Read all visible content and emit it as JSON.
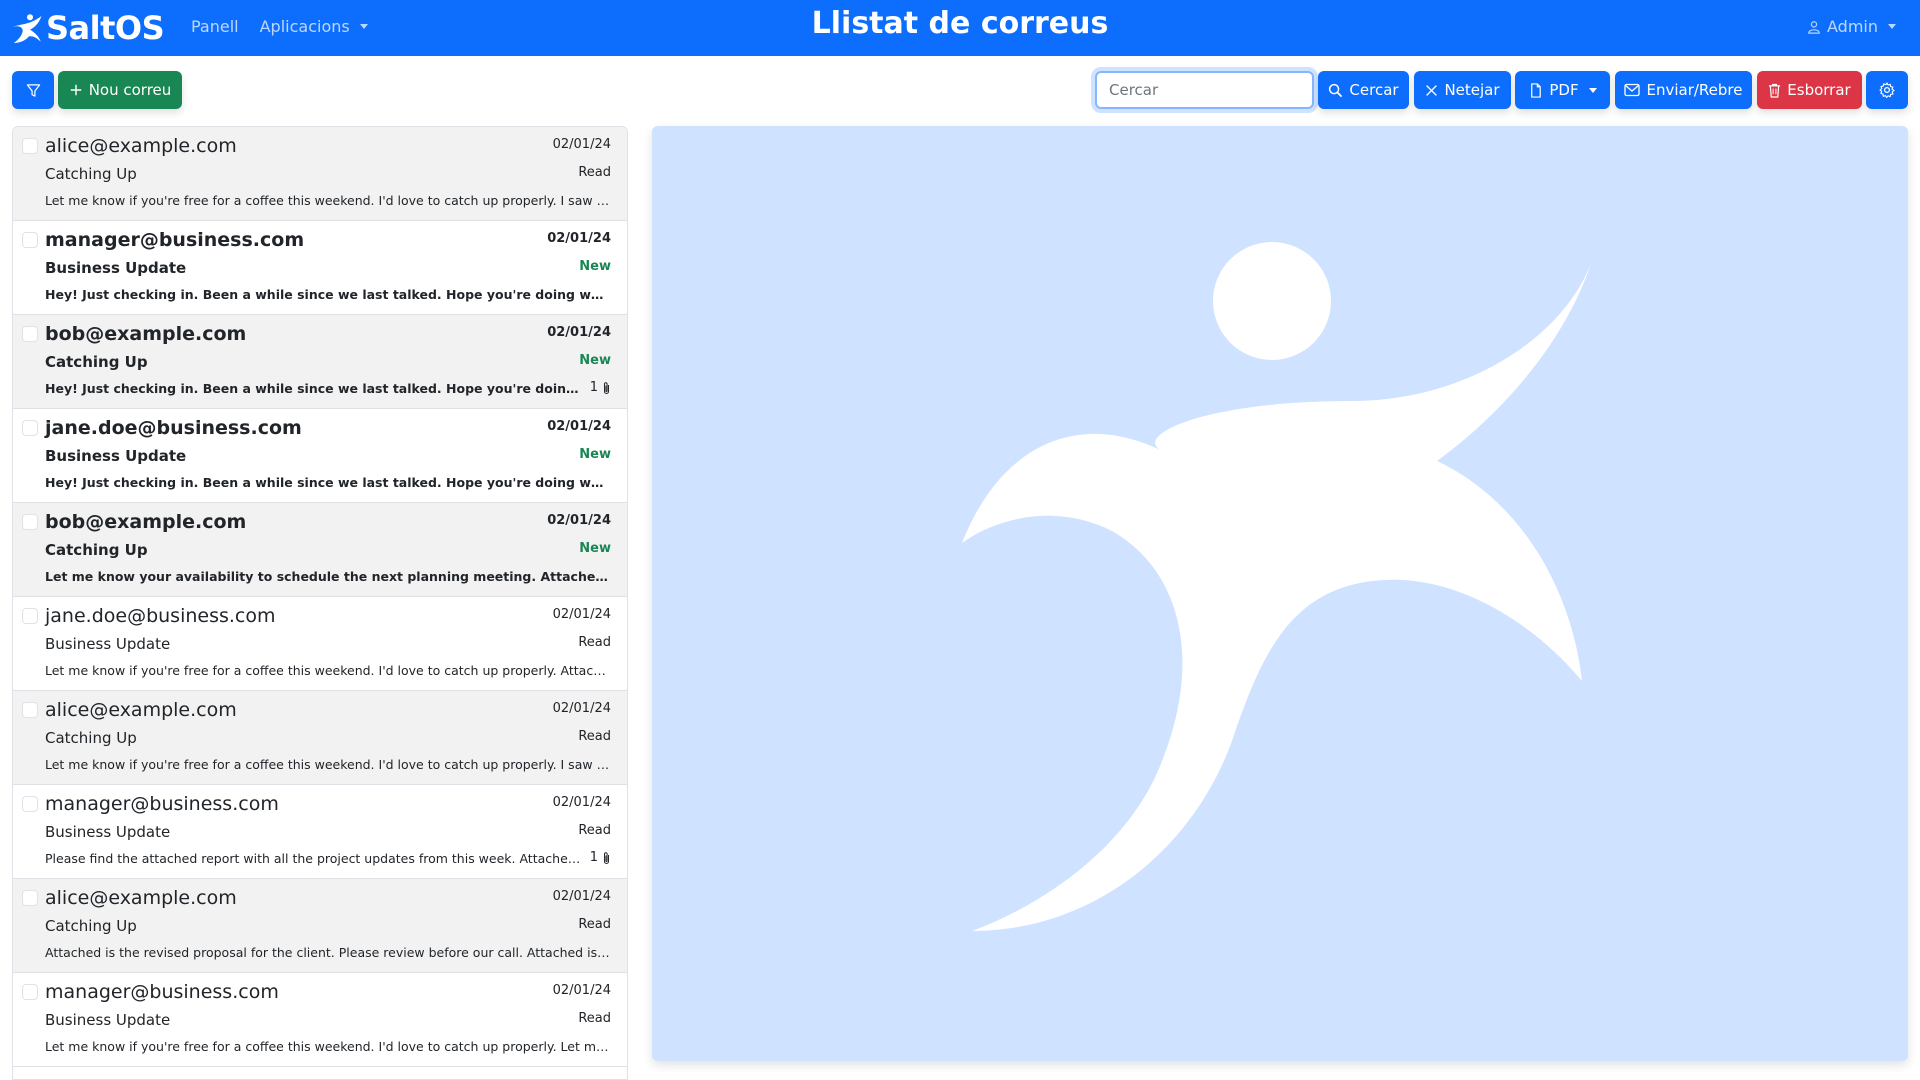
{
  "navbar": {
    "brand": "SaltOS",
    "links": [
      {
        "label": "Panell",
        "dropdown": false
      },
      {
        "label": "Aplicacions",
        "dropdown": true
      }
    ],
    "title": "Llistat de correus",
    "user": "Admin"
  },
  "toolbar": {
    "new_label": "Nou correu",
    "search_placeholder": "Cercar",
    "search_label": "Cercar",
    "clear_label": "Netejar",
    "pdf_label": "PDF",
    "send_receive_label": "Enviar/Rebre",
    "delete_label": "Esborrar"
  },
  "colors": {
    "primary": "#0d6efd",
    "success": "#198754",
    "danger": "#dc3545",
    "preview_bg": "#cfe2ff"
  },
  "emails": [
    {
      "from": "alice@example.com",
      "date": "02/01/24",
      "subject": "Catching Up",
      "status": "Read",
      "unread": false,
      "preview": "Let me know if you're free for a coffee this weekend. I'd love to catch up properly. I saw you at the market last week but you were busy.",
      "attachments": ""
    },
    {
      "from": "manager@business.com",
      "date": "02/01/24",
      "subject": "Business Update",
      "status": "New",
      "unread": true,
      "preview": "Hey! Just checking in. Been a while since we last talked. Hope you're doing well! Hear from you soon.",
      "attachments": ""
    },
    {
      "from": "bob@example.com",
      "date": "02/01/24",
      "subject": "Catching Up",
      "status": "New",
      "unread": true,
      "preview": "Hey! Just checking in. Been a while since we last talked. Hope you're doing well! Attached is the file.",
      "attachments": "1"
    },
    {
      "from": "jane.doe@business.com",
      "date": "02/01/24",
      "subject": "Business Update",
      "status": "New",
      "unread": true,
      "preview": "Hey! Just checking in. Been a while since we last talked. Hope you're doing well! I saw the news.",
      "attachments": ""
    },
    {
      "from": "bob@example.com",
      "date": "02/01/24",
      "subject": "Catching Up",
      "status": "New",
      "unread": true,
      "preview": "Let me know your availability to schedule the next planning meeting. Attached is the agenda for review.",
      "attachments": ""
    },
    {
      "from": "jane.doe@business.com",
      "date": "02/01/24",
      "subject": "Business Update",
      "status": "Read",
      "unread": false,
      "preview": "Let me know if you're free for a coffee this weekend. I'd love to catch up properly. Attached is the invitation.",
      "attachments": ""
    },
    {
      "from": "alice@example.com",
      "date": "02/01/24",
      "subject": "Catching Up",
      "status": "Read",
      "unread": false,
      "preview": "Let me know if you're free for a coffee this weekend. I'd love to catch up properly. I saw you at the market last week.",
      "attachments": ""
    },
    {
      "from": "manager@business.com",
      "date": "02/01/24",
      "subject": "Business Update",
      "status": "Read",
      "unread": false,
      "preview": "Please find the attached report with all the project updates from this week. Attached is the summary.",
      "attachments": "1"
    },
    {
      "from": "alice@example.com",
      "date": "02/01/24",
      "subject": "Catching Up",
      "status": "Read",
      "unread": false,
      "preview": "Attached is the revised proposal for the client. Please review before our call. Attached is the contract.",
      "attachments": ""
    },
    {
      "from": "manager@business.com",
      "date": "02/01/24",
      "subject": "Business Update",
      "status": "Read",
      "unread": false,
      "preview": "Let me know if you're free for a coffee this weekend. I'd love to catch up properly. Let me know what works.",
      "attachments": ""
    }
  ]
}
